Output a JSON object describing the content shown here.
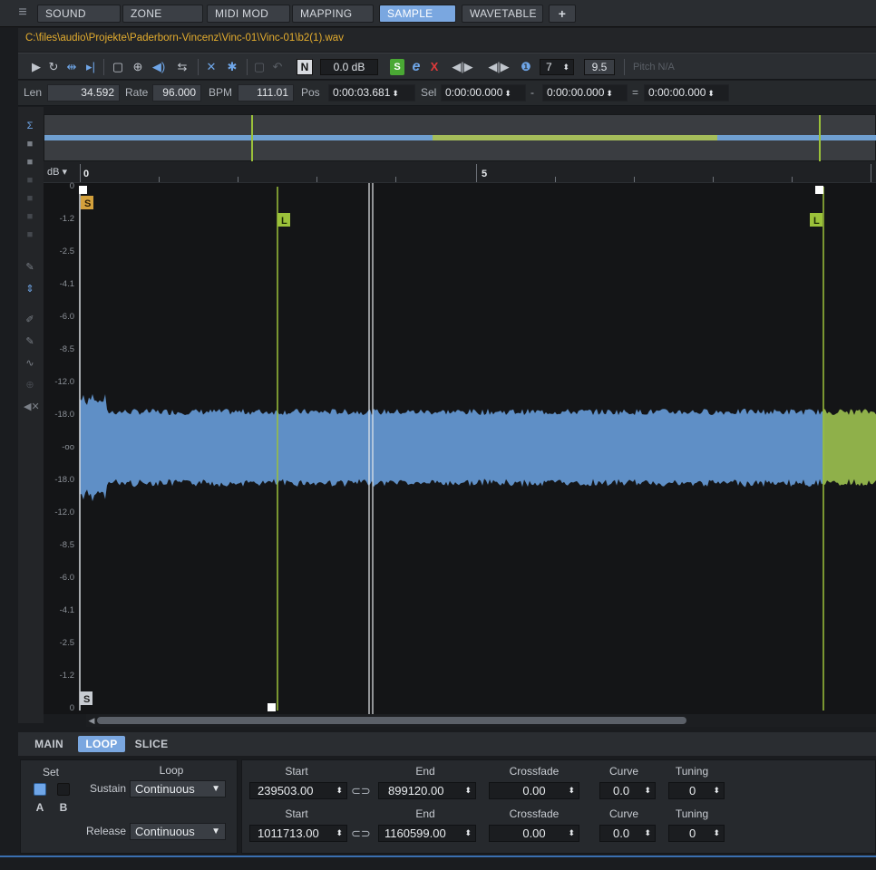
{
  "topbar": {
    "menu_icon": "hamburger-icon",
    "tabs": [
      {
        "label": "SOUND",
        "active": false
      },
      {
        "label": "ZONE",
        "active": false
      },
      {
        "label": "MIDI MOD",
        "active": false
      },
      {
        "label": "MAPPING",
        "active": false
      },
      {
        "label": "SAMPLE",
        "active": true
      },
      {
        "label": "WAVETABLE",
        "active": false
      }
    ],
    "add_tab_label": "+"
  },
  "file": {
    "path": "C:\\files\\audio\\Projekte\\Paderborn-Vincenz\\Vinc-01\\Vinc-01\\b2(1).wav"
  },
  "toolbar": {
    "n_label": "N",
    "level": "0.0 dB",
    "s_label": "S",
    "e_label": "e",
    "x_label": "X",
    "count_value": "7",
    "value_field": "9.5",
    "pitch_label": "Pitch  N/A",
    "accent_green": "#4aa834",
    "accent_red": "#e03a3a",
    "accent_blue": "#6fa6e8"
  },
  "info": {
    "len_label": "Len",
    "len_value": "34.592",
    "rate_label": "Rate",
    "rate_value": "96.000",
    "bpm_label": "BPM",
    "bpm_value": "111.01",
    "pos_label": "Pos",
    "pos_value": "0:00:03.681",
    "sel_label": "Sel",
    "sel_start": "0:00:00.000",
    "dash": "-",
    "sel_end": "0:00:00.000",
    "equals": "=",
    "sel_length": "0:00:00.000"
  },
  "ruler": {
    "db_label": "dB",
    "labels": [
      "0",
      "5"
    ]
  },
  "waveform": {
    "db_scale": [
      "0",
      "-1.2",
      "-2.5",
      "-4.1",
      "-6.0",
      "-8.5",
      "-12.0",
      "-18.0",
      "-oo",
      "-18.0",
      "-12.0",
      "-8.5",
      "-6.0",
      "-4.1",
      "-2.5",
      "-1.2",
      "0"
    ],
    "start_marker": "S",
    "sustain_marker": "S",
    "loop_start_marker": "L",
    "loop_end_marker": "L",
    "wave_color": "#5f8fc6",
    "loop_color": "#8fb04a",
    "marker_color": "#9bc13a"
  },
  "bottom_tabs": [
    {
      "label": "MAIN",
      "active": false
    },
    {
      "label": "LOOP",
      "active": true
    },
    {
      "label": "SLICE",
      "active": false
    }
  ],
  "set": {
    "header": "Set",
    "a_label": "A",
    "b_label": "B"
  },
  "loop": {
    "header": "Loop",
    "sustain_label": "Sustain",
    "sustain_mode": "Continuous",
    "release_label": "Release",
    "release_mode": "Continuous",
    "columns": {
      "start": "Start",
      "end": "End",
      "crossfade": "Crossfade",
      "curve": "Curve",
      "tuning": "Tuning"
    },
    "sustain_row": {
      "start": "239503.00",
      "end": "899120.00",
      "crossfade": "0.00",
      "curve": "0.0",
      "tuning": "0"
    },
    "release_row": {
      "start": "1011713.00",
      "end": "1160599.00",
      "crossfade": "0.00",
      "curve": "0.0",
      "tuning": "0"
    }
  }
}
